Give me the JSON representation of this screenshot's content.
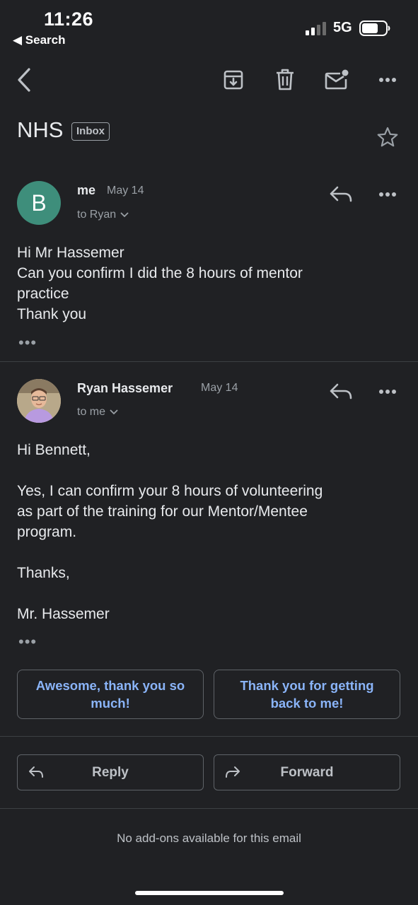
{
  "status_bar": {
    "time": "11:26",
    "back_app": "◀ Search",
    "network": "5G"
  },
  "toolbar": {
    "icons": [
      "back-arrow-icon",
      "archive-icon",
      "trash-icon",
      "mark-unread-icon",
      "more-icon"
    ]
  },
  "thread": {
    "subject": "NHS",
    "label": "Inbox"
  },
  "messages": [
    {
      "avatar_letter": "B",
      "avatar_color": "#3e8e7b",
      "sender": "me",
      "date": "May 14",
      "recipient": "to Ryan",
      "body": "Hi Mr Hassemer\nCan you confirm I did the 8 hours of mentor\npractice\nThank you",
      "trimmed_indicator": "•••"
    },
    {
      "sender": "Ryan Hassemer",
      "date": "May 14",
      "recipient": "to me",
      "body": "Hi Bennett,\n\nYes, I can confirm your 8 hours of volunteering\nas part of the training for our Mentor/Mentee\nprogram.\n\nThanks,\n\nMr. Hassemer",
      "trimmed_indicator": "•••"
    }
  ],
  "smart_replies": [
    "Awesome, thank you so much!",
    "Thank you for getting back to me!"
  ],
  "actions": {
    "reply": "Reply",
    "forward": "Forward"
  },
  "footer": {
    "addons": "No add-ons available for this email"
  },
  "colors": {
    "background": "#202124",
    "accent": "#8ab4f8",
    "divider": "#3c4043"
  }
}
